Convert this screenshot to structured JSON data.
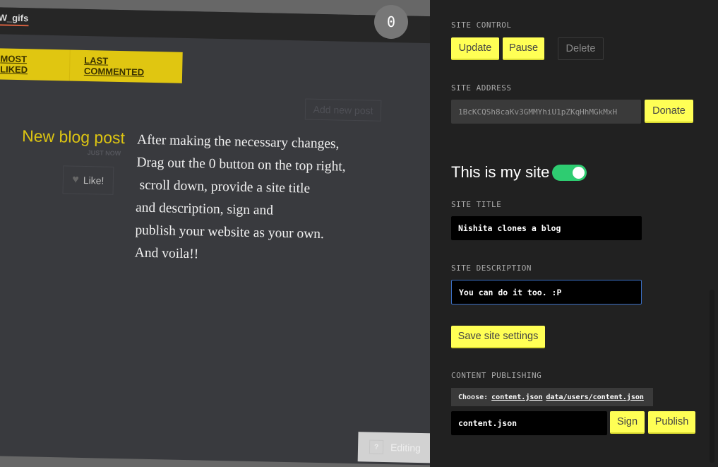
{
  "blog": {
    "topbar_link": "W_gifs",
    "tabs": [
      "MOST LIKED",
      "LAST COMMENTED"
    ],
    "add_post": "Add new post",
    "post": {
      "title": "New blog post",
      "time": "JUST NOW",
      "like": "Like!",
      "body": "After making the necessary changes,\nDrag out the 0 button on the top right,\n scroll down, provide a site title\nand description, sign and\npublish your website as your own.\nAnd voila!!"
    },
    "editing_help": "?",
    "editing_label": "Editing"
  },
  "corner_button": "0",
  "sidebar": {
    "site_control": {
      "label": "SITE CONTROL",
      "update": "Update",
      "pause": "Pause",
      "delete": "Delete"
    },
    "site_address": {
      "label": "SITE ADDRESS",
      "value": "1BcKCQSh8caKv3GMMYhiU1pZKqHhMGkMxH",
      "donate": "Donate"
    },
    "my_site": {
      "label": "This is my site",
      "enabled": true,
      "toggle_color": "#2ecc71"
    },
    "site_title": {
      "label": "SITE TITLE",
      "value": "Nishita clones a blog"
    },
    "site_description": {
      "label": "SITE DESCRIPTION",
      "value": "You can do it too. :P"
    },
    "save": "Save site settings",
    "publishing": {
      "label": "CONTENT PUBLISHING",
      "choose": "Choose:",
      "options": [
        "content.json",
        "data/users/content.json"
      ],
      "value": "content.json",
      "sign": "Sign",
      "publish": "Publish"
    }
  },
  "colors": {
    "accent": "#ffff55",
    "blog_accent": "#e0c611"
  }
}
